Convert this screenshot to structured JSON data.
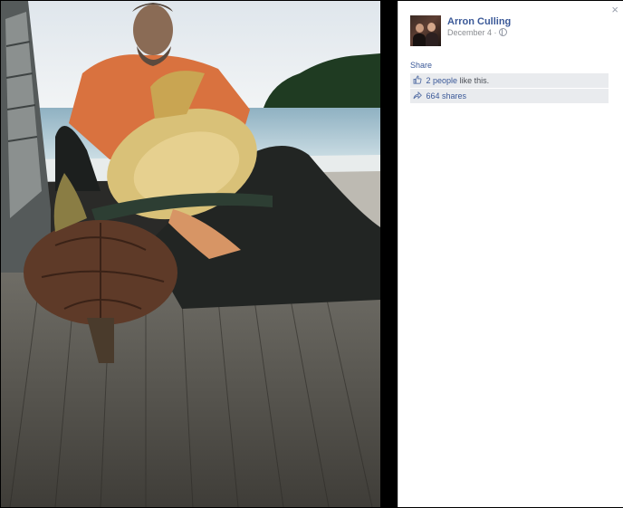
{
  "post": {
    "author_name": "Arron Culling",
    "date": "December 4",
    "separator": "·",
    "privacy_icon": "globe-icon"
  },
  "actions": {
    "share_label": "Share"
  },
  "stats": {
    "like_icon": "thumbs-up-icon",
    "likes_link": "2 people",
    "likes_suffix": "like this.",
    "shares_icon": "share-arrow-icon",
    "shares_link": "664 shares"
  },
  "controls": {
    "close_glyph": "×"
  },
  "colors": {
    "link": "#3b5998",
    "stat_bg": "#e9ebee",
    "background": "#000000"
  }
}
